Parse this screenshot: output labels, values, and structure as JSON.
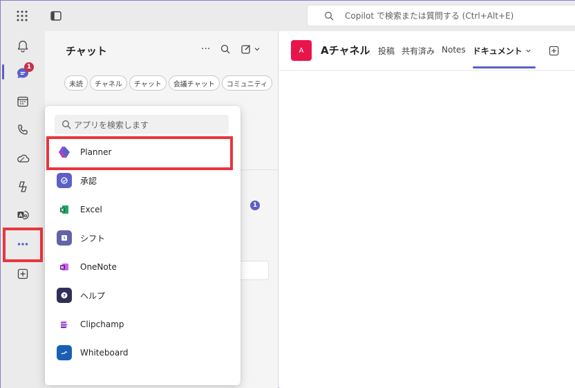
{
  "topbar": {
    "search_placeholder": "Copilot で検索または質問する (Ctrl+Alt+E)"
  },
  "rail": {
    "chat_badge": "1",
    "items": [
      "bell-icon",
      "chat-icon",
      "calendar-icon",
      "phone-icon",
      "onedrive-icon",
      "copilot-icon",
      "translate-icon",
      "more-icon",
      "add-icon"
    ]
  },
  "chat": {
    "title": "チャット",
    "actions": [
      "···",
      "search-icon",
      "compose-icon"
    ],
    "filters": [
      "未読",
      "チャネル",
      "チャット",
      "会議チャット",
      "コミュニティ"
    ],
    "unread_count": "1"
  },
  "channel": {
    "avatar_letter": "A",
    "name": "Aチャネル",
    "tabs": [
      "投稿",
      "共有済み",
      "Notes",
      "ドキュメント"
    ],
    "active_tab": "ドキュメント",
    "colors": {
      "avatar": "#e8154b",
      "accent": "#5b5fc7"
    }
  },
  "flyout": {
    "search_placeholder": "アプリを検索します",
    "apps": [
      {
        "label": "Planner",
        "icon": "planner-icon",
        "color": "#7b3fe4"
      },
      {
        "label": "承認",
        "icon": "approvals-icon",
        "color": "#5b5fc7"
      },
      {
        "label": "Excel",
        "icon": "excel-icon",
        "color": "#1d7a43"
      },
      {
        "label": "シフト",
        "icon": "shifts-icon",
        "color": "#6264a7"
      },
      {
        "label": "OneNote",
        "icon": "onenote-icon",
        "color": "#8c3fc1"
      },
      {
        "label": "ヘルプ",
        "icon": "help-icon",
        "color": "#2f2f5a"
      },
      {
        "label": "Clipchamp",
        "icon": "clipchamp-icon",
        "color": "#8c43e6"
      },
      {
        "label": "Whiteboard",
        "icon": "whiteboard-icon",
        "color": "#1a5fb4"
      }
    ]
  }
}
